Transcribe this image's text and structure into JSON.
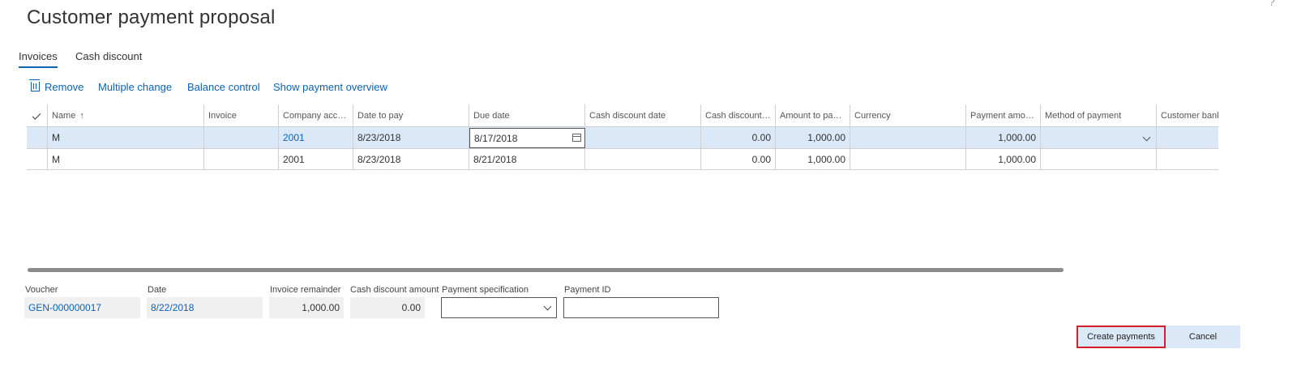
{
  "window": {
    "title": "Customer payment proposal",
    "help_glyph": "?"
  },
  "tabs": [
    {
      "label": "Invoices",
      "active": true
    },
    {
      "label": "Cash discount",
      "active": false
    }
  ],
  "toolbar": {
    "remove": "Remove",
    "multiple_change": "Multiple change",
    "balance_control": "Balance control",
    "show_payment_overview": "Show payment overview"
  },
  "grid": {
    "columns": {
      "name": "Name",
      "invoice": "Invoice",
      "company_account": "Company accou...",
      "date_to_pay": "Date to pay",
      "due_date": "Due date",
      "cash_discount_date": "Cash discount date",
      "cash_discount_amount": "Cash discount a...",
      "amount_to_pay": "Amount to pay i...",
      "currency": "Currency",
      "payment_amount": "Payment amount",
      "method_of_payment": "Method of payment",
      "customer_bank": "Customer bank"
    },
    "rows": [
      {
        "name": "M",
        "invoice": "",
        "company_account": "2001",
        "date_to_pay": "8/23/2018",
        "due_date": "8/17/2018",
        "cash_discount_date": "",
        "cash_discount_amount": "0.00",
        "amount_to_pay": "1,000.00",
        "currency": "",
        "payment_amount": "1,000.00",
        "method_of_payment": "",
        "customer_bank": "",
        "selected": true
      },
      {
        "name": "M",
        "invoice": "",
        "company_account": "2001",
        "date_to_pay": "8/23/2018",
        "due_date": "8/21/2018",
        "cash_discount_date": "",
        "cash_discount_amount": "0.00",
        "amount_to_pay": "1,000.00",
        "currency": "",
        "payment_amount": "1,000.00",
        "method_of_payment": "",
        "customer_bank": "",
        "selected": false
      }
    ]
  },
  "footer": {
    "voucher_label": "Voucher",
    "voucher_value": "GEN-000000017",
    "date_label": "Date",
    "date_value": "8/22/2018",
    "invoice_remainder_label": "Invoice remainder",
    "invoice_remainder_value": "1,000.00",
    "cash_discount_amount_label": "Cash discount amount",
    "cash_discount_amount_value": "0.00",
    "payment_specification_label": "Payment specification",
    "payment_specification_value": "",
    "payment_id_label": "Payment ID",
    "payment_id_value": ""
  },
  "buttons": {
    "create_payments": "Create payments",
    "cancel": "Cancel"
  },
  "colors": {
    "accent": "#0b62b6",
    "selected_row": "#dbe8f7",
    "highlight_border": "#d0202c"
  }
}
